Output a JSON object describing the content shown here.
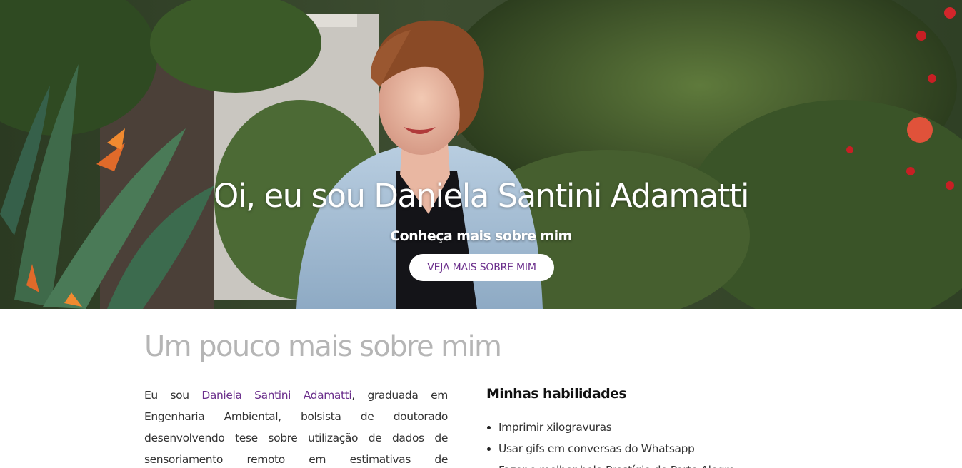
{
  "hero": {
    "title": "Oi, eu sou Daniela Santini Adamatti",
    "subtitle": "Conheça mais sobre mim",
    "button_label": "VEJA MAIS SOBRE MIM"
  },
  "about": {
    "section_title": "Um pouco mais sobre mim",
    "intro_before_name": "Eu sou ",
    "name_link": "Daniela Santini Adamatti",
    "intro_after_name": ", graduada em Engenharia Ambiental, bolsista de doutorado desenvolvendo tese sobre utilização de dados de sensoriamento remoto em estimativas de"
  },
  "skills": {
    "title": "Minhas habilidades",
    "items": [
      "Imprimir xilogravuras",
      "Usar gifs em conversas do Whatsapp",
      "Fazer o melhor bolo Prestígio de Porto Alegre"
    ]
  },
  "colors": {
    "accent": "#6b2f8c",
    "section_title": "#b5b5b5",
    "text": "#333333"
  }
}
